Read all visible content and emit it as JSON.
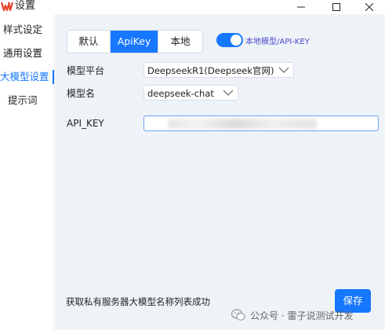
{
  "window": {
    "title": "设置"
  },
  "sidebar": {
    "items": [
      {
        "label": "样式设定",
        "active": false
      },
      {
        "label": "通用设置",
        "active": false
      },
      {
        "label": "大模型设置",
        "active": true
      },
      {
        "label": "提示词",
        "active": false
      }
    ]
  },
  "main": {
    "mode_tabs": [
      {
        "label": "默认",
        "active": false
      },
      {
        "label": "ApiKey",
        "active": true
      },
      {
        "label": "本地",
        "active": false
      }
    ],
    "toggle": {
      "on": true,
      "label": "本地模型/API-KEY"
    },
    "platform": {
      "label": "模型平台",
      "value": "DeepseekR1(Deepseek官网)"
    },
    "model": {
      "label": "模型名",
      "value": "deepseek-chat"
    },
    "api_key": {
      "label": "API_KEY",
      "value": ""
    },
    "status_text": "获取私有服务器大模型名称列表成功",
    "save_label": "保存"
  },
  "watermark": {
    "text": "公众号 · 雷子说测试开发"
  },
  "colors": {
    "accent": "#1677ff",
    "content_bg": "#eef3f8",
    "toggle_label": "#4d4acb"
  }
}
